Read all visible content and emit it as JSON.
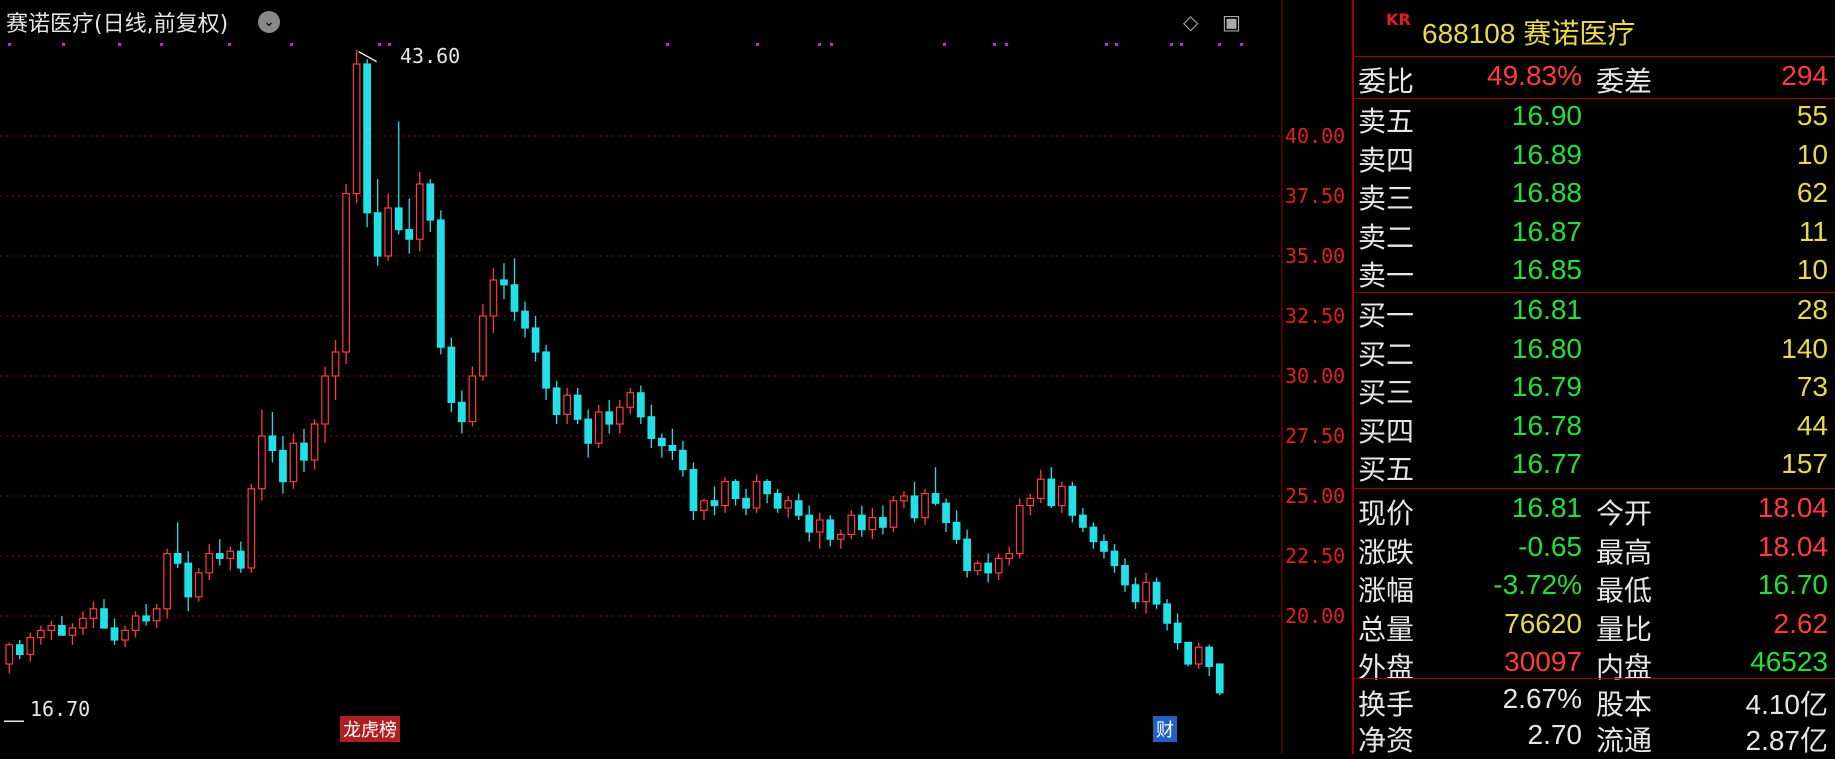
{
  "chart": {
    "title": "赛诺医疗(日线,前复权)",
    "y_ticks": [
      "40.00",
      "37.50",
      "35.00",
      "32.50",
      "30.00",
      "27.50",
      "25.00",
      "22.50",
      "20.00"
    ],
    "high_label": "43.60",
    "low_label": "16.70",
    "tag_left": "龙虎榜",
    "tag_right": "财"
  },
  "chart_data": {
    "type": "candlestick",
    "ylim": [
      16.0,
      44.0
    ],
    "y_ticks": [
      20.0,
      22.5,
      25.0,
      27.5,
      30.0,
      32.5,
      35.0,
      37.5,
      40.0
    ],
    "grid": true,
    "candles": [
      [
        18.0,
        18.9,
        17.6,
        18.8
      ],
      [
        18.8,
        19.0,
        18.2,
        18.4
      ],
      [
        18.4,
        19.3,
        18.1,
        19.1
      ],
      [
        19.1,
        19.6,
        18.8,
        19.4
      ],
      [
        19.4,
        19.8,
        19.0,
        19.6
      ],
      [
        19.6,
        20.0,
        19.3,
        19.2
      ],
      [
        19.2,
        19.7,
        18.8,
        19.5
      ],
      [
        19.5,
        20.2,
        19.2,
        19.9
      ],
      [
        19.9,
        20.6,
        19.5,
        20.3
      ],
      [
        20.3,
        20.7,
        19.6,
        19.5
      ],
      [
        19.5,
        19.9,
        18.8,
        19.0
      ],
      [
        19.0,
        19.6,
        18.7,
        19.4
      ],
      [
        19.4,
        20.2,
        19.1,
        20.0
      ],
      [
        20.0,
        20.5,
        19.6,
        19.8
      ],
      [
        19.8,
        20.5,
        19.5,
        20.3
      ],
      [
        20.3,
        22.8,
        19.9,
        22.6
      ],
      [
        22.6,
        23.9,
        22.0,
        22.2
      ],
      [
        22.2,
        22.7,
        20.2,
        20.8
      ],
      [
        20.8,
        22.0,
        20.6,
        21.8
      ],
      [
        21.8,
        23.0,
        21.5,
        22.6
      ],
      [
        22.6,
        23.2,
        22.1,
        22.4
      ],
      [
        22.4,
        22.9,
        21.9,
        22.7
      ],
      [
        22.7,
        23.1,
        21.8,
        22.0
      ],
      [
        22.0,
        25.5,
        21.8,
        25.3
      ],
      [
        25.3,
        28.6,
        24.8,
        27.5
      ],
      [
        27.5,
        28.5,
        26.4,
        26.9
      ],
      [
        26.9,
        27.5,
        25.1,
        25.6
      ],
      [
        25.6,
        27.6,
        25.3,
        27.2
      ],
      [
        27.2,
        27.8,
        26.0,
        26.5
      ],
      [
        26.5,
        28.2,
        26.1,
        28.0
      ],
      [
        28.0,
        30.4,
        27.2,
        30.0
      ],
      [
        30.0,
        31.5,
        29.0,
        31.0
      ],
      [
        31.0,
        38.0,
        30.5,
        37.6
      ],
      [
        37.6,
        43.6,
        37.2,
        43.0
      ],
      [
        43.0,
        43.2,
        36.2,
        36.8
      ],
      [
        36.8,
        38.2,
        34.6,
        35.0
      ],
      [
        35.0,
        37.6,
        34.8,
        37.0
      ],
      [
        37.0,
        40.6,
        35.9,
        36.1
      ],
      [
        36.1,
        37.4,
        35.1,
        35.7
      ],
      [
        35.7,
        38.5,
        35.2,
        38.0
      ],
      [
        38.0,
        38.2,
        36.0,
        36.5
      ],
      [
        36.5,
        36.9,
        30.9,
        31.2
      ],
      [
        31.2,
        31.6,
        28.5,
        28.9
      ],
      [
        28.9,
        29.4,
        27.6,
        28.1
      ],
      [
        28.1,
        30.4,
        27.9,
        30.0
      ],
      [
        30.0,
        33.0,
        29.8,
        32.5
      ],
      [
        32.5,
        34.5,
        31.8,
        34.0
      ],
      [
        34.0,
        34.7,
        33.2,
        33.8
      ],
      [
        33.8,
        34.9,
        32.3,
        32.7
      ],
      [
        32.7,
        33.1,
        31.6,
        32.0
      ],
      [
        32.0,
        32.5,
        30.6,
        31.0
      ],
      [
        31.0,
        31.3,
        29.0,
        29.5
      ],
      [
        29.5,
        29.8,
        28.0,
        28.4
      ],
      [
        28.4,
        29.5,
        28.0,
        29.2
      ],
      [
        29.2,
        29.5,
        28.0,
        28.2
      ],
      [
        28.2,
        28.6,
        26.6,
        27.2
      ],
      [
        27.2,
        28.8,
        27.0,
        28.5
      ],
      [
        28.5,
        29.0,
        27.6,
        28.0
      ],
      [
        28.0,
        29.0,
        27.6,
        28.7
      ],
      [
        28.7,
        29.5,
        28.4,
        29.3
      ],
      [
        29.3,
        29.6,
        28.0,
        28.3
      ],
      [
        28.3,
        28.8,
        27.0,
        27.4
      ],
      [
        27.4,
        27.6,
        26.6,
        27.1
      ],
      [
        27.1,
        27.8,
        26.5,
        26.9
      ],
      [
        26.9,
        27.3,
        25.8,
        26.1
      ],
      [
        26.1,
        26.4,
        24.0,
        24.4
      ],
      [
        24.4,
        24.9,
        24.0,
        24.8
      ],
      [
        24.8,
        25.4,
        24.2,
        24.6
      ],
      [
        24.6,
        25.8,
        24.3,
        25.6
      ],
      [
        25.6,
        25.7,
        24.6,
        24.9
      ],
      [
        24.9,
        25.3,
        24.2,
        24.5
      ],
      [
        24.5,
        25.9,
        24.3,
        25.6
      ],
      [
        25.6,
        25.7,
        24.7,
        25.1
      ],
      [
        25.1,
        25.3,
        24.3,
        24.5
      ],
      [
        24.5,
        25.0,
        24.1,
        24.8
      ],
      [
        24.8,
        25.1,
        24.0,
        24.2
      ],
      [
        24.2,
        24.6,
        23.1,
        23.5
      ],
      [
        23.5,
        24.3,
        22.8,
        24.0
      ],
      [
        24.0,
        24.2,
        22.9,
        23.2
      ],
      [
        23.2,
        23.6,
        22.8,
        23.4
      ],
      [
        23.4,
        24.4,
        23.2,
        24.2
      ],
      [
        24.2,
        24.6,
        23.3,
        23.6
      ],
      [
        23.6,
        24.5,
        23.2,
        24.1
      ],
      [
        24.1,
        24.6,
        23.4,
        23.7
      ],
      [
        23.7,
        25.0,
        23.5,
        24.8
      ],
      [
        24.8,
        25.2,
        24.5,
        25.0
      ],
      [
        25.0,
        25.6,
        23.9,
        24.1
      ],
      [
        24.1,
        25.3,
        23.8,
        25.1
      ],
      [
        25.1,
        26.2,
        24.6,
        24.7
      ],
      [
        24.7,
        24.9,
        23.5,
        23.9
      ],
      [
        23.9,
        24.4,
        23.0,
        23.2
      ],
      [
        23.2,
        23.6,
        21.6,
        21.9
      ],
      [
        21.9,
        22.3,
        21.7,
        22.2
      ],
      [
        22.2,
        22.6,
        21.4,
        21.8
      ],
      [
        21.8,
        22.6,
        21.5,
        22.4
      ],
      [
        22.4,
        22.9,
        22.1,
        22.6
      ],
      [
        22.6,
        24.9,
        22.4,
        24.6
      ],
      [
        24.6,
        25.1,
        24.2,
        24.9
      ],
      [
        24.9,
        26.1,
        24.7,
        25.7
      ],
      [
        25.7,
        26.2,
        24.5,
        24.6
      ],
      [
        24.6,
        25.6,
        24.3,
        25.4
      ],
      [
        25.4,
        25.6,
        23.9,
        24.2
      ],
      [
        24.2,
        24.5,
        23.5,
        23.7
      ],
      [
        23.7,
        23.9,
        22.8,
        23.1
      ],
      [
        23.1,
        23.4,
        22.4,
        22.7
      ],
      [
        22.7,
        23.0,
        21.8,
        22.1
      ],
      [
        22.1,
        22.4,
        21.0,
        21.3
      ],
      [
        21.3,
        21.6,
        20.3,
        20.6
      ],
      [
        20.6,
        21.8,
        20.1,
        21.4
      ],
      [
        21.4,
        21.6,
        20.3,
        20.5
      ],
      [
        20.5,
        20.7,
        19.4,
        19.7
      ],
      [
        19.7,
        20.1,
        18.6,
        18.9
      ],
      [
        18.9,
        18.9,
        17.9,
        18.0
      ],
      [
        18.0,
        18.9,
        17.8,
        18.7
      ],
      [
        18.7,
        18.8,
        17.5,
        17.9
      ],
      [
        18.0,
        18.0,
        16.7,
        16.8
      ]
    ]
  },
  "quote": {
    "kr": "KR",
    "code_name": "688108 赛诺医疗",
    "weibi_label": "委比",
    "weibi": "49.83%",
    "weicha_label": "委差",
    "weicha": "294",
    "asks": [
      {
        "label": "卖五",
        "price": "16.90",
        "vol": "55"
      },
      {
        "label": "卖四",
        "price": "16.89",
        "vol": "10"
      },
      {
        "label": "卖三",
        "price": "16.88",
        "vol": "62"
      },
      {
        "label": "卖二",
        "price": "16.87",
        "vol": "11"
      },
      {
        "label": "卖一",
        "price": "16.85",
        "vol": "10"
      }
    ],
    "bids": [
      {
        "label": "买一",
        "price": "16.81",
        "vol": "28"
      },
      {
        "label": "买二",
        "price": "16.80",
        "vol": "140"
      },
      {
        "label": "买三",
        "price": "16.79",
        "vol": "73"
      },
      {
        "label": "买四",
        "price": "16.78",
        "vol": "44"
      },
      {
        "label": "买五",
        "price": "16.77",
        "vol": "157"
      }
    ],
    "stats": [
      {
        "l1": "现价",
        "v1": "16.81",
        "l2": "今开",
        "v2": "18.04"
      },
      {
        "l1": "涨跌",
        "v1": "-0.65",
        "l2": "最高",
        "v2": "18.04"
      },
      {
        "l1": "涨幅",
        "v1": "-3.72%",
        "l2": "最低",
        "v2": "16.70"
      },
      {
        "l1": "总量",
        "v1": "76620",
        "l2": "量比",
        "v2": "2.62"
      },
      {
        "l1": "外盘",
        "v1": "30097",
        "l2": "内盘",
        "v2": "46523"
      },
      {
        "l1": "换手",
        "v1": "2.67%",
        "l2": "股本",
        "v2": "4.10亿"
      },
      {
        "l1": "净资",
        "v1": "2.70",
        "l2": "流通",
        "v2": "2.87亿"
      }
    ]
  }
}
